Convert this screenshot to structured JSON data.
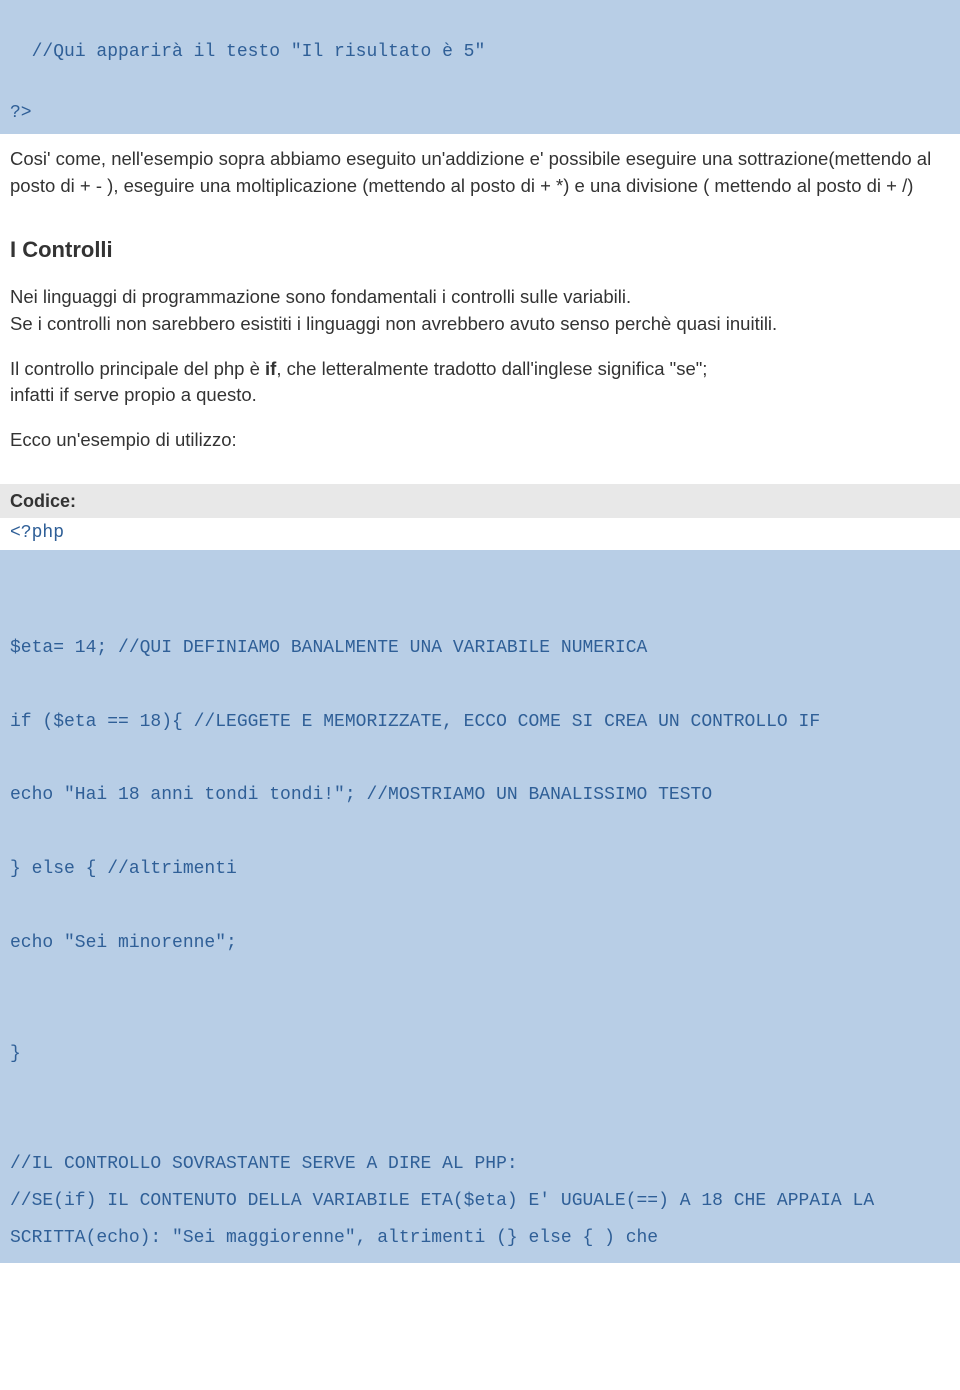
{
  "codeTop": "//Qui apparirà il testo \"Il risultato è 5\"\n\n?>",
  "para1": "Cosi' come, nell'esempio sopra abbiamo eseguito un'addizione e' possibile eseguire una sottrazione(mettendo al posto di + - ), eseguire una moltiplicazione (mettendo al posto di + *) e una divisione ( mettendo al posto di + /)",
  "heading1": "I Controlli",
  "para2a": "Nei linguaggi di programmazione sono fondamentali i controlli sulle variabili.",
  "para2b": "Se i controlli non sarebbero esistiti i linguaggi non avrebbero avuto senso perchè quasi inuitili.",
  "para3a": "Il controllo principale del php è ",
  "para3bold": "if",
  "para3b": ", che letteralmente tradotto dall'inglese significa \"se\";",
  "para3c": "infatti if serve propio a questo.",
  "para4": "Ecco un'esempio di utilizzo:",
  "codiceLabel": "Codice:",
  "phpOpen": "<?php",
  "codeMain": "\n$eta= 14; //QUI DEFINIAMO BANALMENTE UNA VARIABILE NUMERICA\n\nif ($eta == 18){ //LEGGETE E MEMORIZZATE, ECCO COME SI CREA UN CONTROLLO IF\n\necho \"Hai 18 anni tondi tondi!\"; //MOSTRIAMO UN BANALISSIMO TESTO\n\n} else { //altrimenti\n\necho \"Sei minorenne\";\n\n\n}\n\n\n//IL CONTROLLO SOVRASTANTE SERVE A DIRE AL PHP:\n//SE(if) IL CONTENUTO DELLA VARIABILE ETA($eta) E' UGUALE(==) A 18 CHE APPAIA LA SCRITTA(echo): \"Sei maggiorenne\", altrimenti (} else { ) che"
}
